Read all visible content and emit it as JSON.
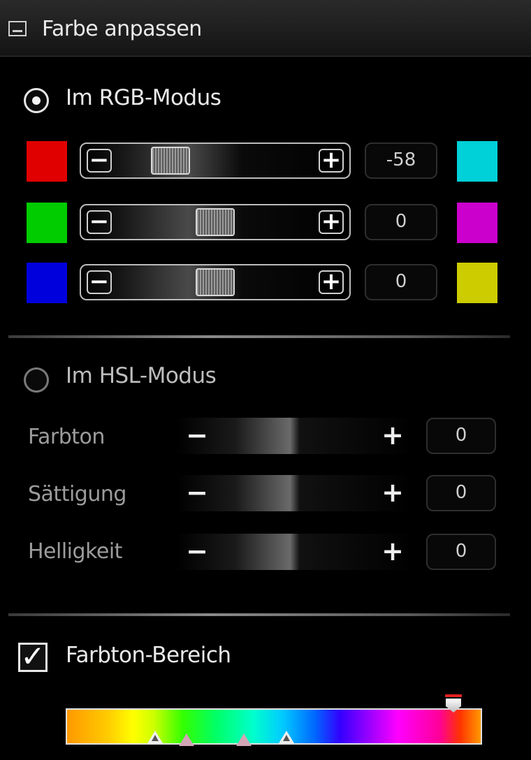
{
  "window": {
    "title": "Farbe anpassen",
    "icon": "panel-icon"
  },
  "rgb_mode": {
    "label": "Im RGB-Modus",
    "selected": true,
    "rows": [
      {
        "channel": "red",
        "left_color": "#e00000",
        "right_color": "#00d0d8",
        "value": "-58",
        "position": 0.35
      },
      {
        "channel": "green",
        "left_color": "#00cc00",
        "right_color": "#cc00cc",
        "value": "0",
        "position": 0.5
      },
      {
        "channel": "blue",
        "left_color": "#0000dd",
        "right_color": "#cccc00",
        "value": "0",
        "position": 0.5
      }
    ],
    "minus_label": "−",
    "plus_label": "+"
  },
  "hsl_mode": {
    "label": "Im HSL-Modus",
    "selected": false,
    "rows": [
      {
        "label": "Farbton",
        "value": "0",
        "position": 0.5
      },
      {
        "label": "Sättigung",
        "value": "0",
        "position": 0.5
      },
      {
        "label": "Helligkeit",
        "value": "0",
        "position": 0.5
      }
    ],
    "minus_label": "−",
    "plus_label": "+"
  },
  "hue_range": {
    "label": "Farbton-Bereich",
    "checked": true,
    "check_glyph": "✓",
    "marker_color": "#e02020"
  }
}
